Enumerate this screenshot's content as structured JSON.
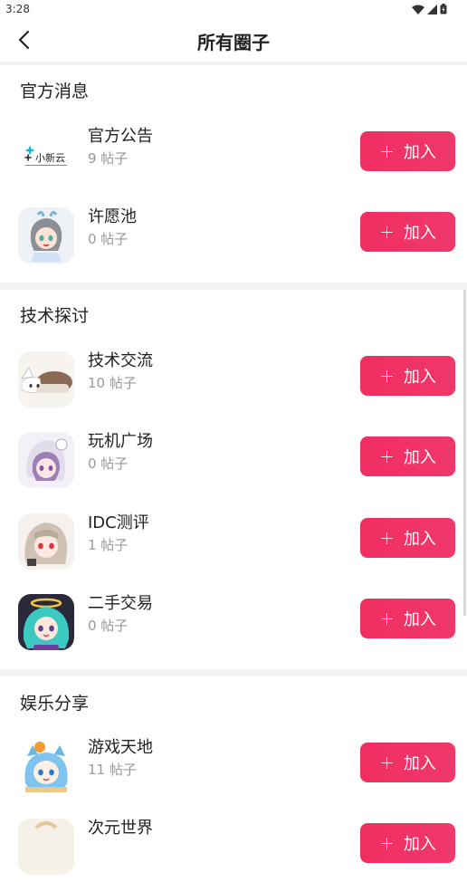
{
  "status": {
    "time": "3:28"
  },
  "header": {
    "title": "所有圈子"
  },
  "sections": [
    {
      "title": "官方消息",
      "items": [
        {
          "name": "官方公告",
          "count": "9 帖子",
          "join": "加入",
          "avatar": "logo"
        },
        {
          "name": "许愿池",
          "count": "0 帖子",
          "join": "加入",
          "avatar": "anime"
        }
      ]
    },
    {
      "title": "技术探讨",
      "items": [
        {
          "name": "技术交流",
          "count": "10 帖子",
          "join": "加入",
          "avatar": "anime"
        },
        {
          "name": "玩机广场",
          "count": "0 帖子",
          "join": "加入",
          "avatar": "anime"
        },
        {
          "name": "IDC测评",
          "count": "1 帖子",
          "join": "加入",
          "avatar": "anime"
        },
        {
          "name": "二手交易",
          "count": "0 帖子",
          "join": "加入",
          "avatar": "anime"
        }
      ]
    },
    {
      "title": "娱乐分享",
      "items": [
        {
          "name": "游戏天地",
          "count": "11 帖子",
          "join": "加入",
          "avatar": "anime"
        },
        {
          "name": "次元世界",
          "count": "",
          "join": "加入",
          "avatar": "anime"
        }
      ]
    }
  ],
  "logo_text": "小新云",
  "colors": {
    "accent": "#f02e62",
    "count_text": "#999999",
    "divider": "#f3f3f5"
  }
}
